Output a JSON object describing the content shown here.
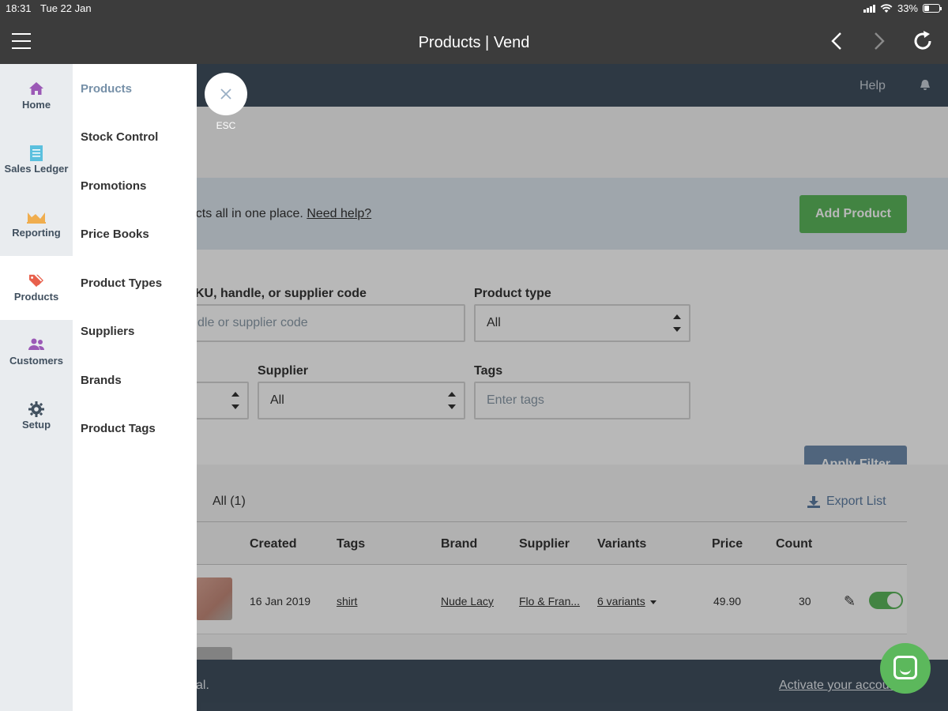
{
  "status_bar": {
    "time": "18:31",
    "date": "Tue 22 Jan",
    "battery": "33%"
  },
  "nav_bar": {
    "title": "Products | Vend"
  },
  "app_header": {
    "help": "Help"
  },
  "banner": {
    "text": "ducts all in one place.",
    "link": "Need help?",
    "add_product": "Add Product"
  },
  "filters": {
    "search_label": "KU, handle, or supplier code",
    "search_placeholder": "dle or supplier code",
    "product_type_label": "Product type",
    "product_type_value": "All",
    "supplier_label": "Supplier",
    "supplier_value": "All",
    "tags_label": "Tags",
    "tags_placeholder": "Enter tags",
    "apply_filter": "Apply Filter"
  },
  "list": {
    "tab_all": "All (1)",
    "export": "Export List",
    "columns": [
      "Created",
      "Tags",
      "Brand",
      "Supplier",
      "Variants",
      "Price",
      "Count"
    ],
    "rows": [
      {
        "created": "16 Jan 2019",
        "tags": "shirt",
        "brand": "Nude Lacy",
        "supplier": "Flo & Fran...",
        "variants": "6 variants",
        "price": "49.90",
        "count": "30"
      }
    ]
  },
  "footer": {
    "text": "al.",
    "link": "Activate your accou     w."
  },
  "rail": {
    "items": [
      {
        "label": "Home",
        "icon": "home-icon",
        "color": "#9b59b6"
      },
      {
        "label": "Sales Ledger",
        "icon": "ledger-icon",
        "color": "#5bc0de"
      },
      {
        "label": "Reporting",
        "icon": "reporting-icon",
        "color": "#f0ad4e"
      },
      {
        "label": "Products",
        "icon": "tag-icon",
        "color": "#e8604c"
      },
      {
        "label": "Customers",
        "icon": "customers-icon",
        "color": "#9b59b6"
      },
      {
        "label": "Setup",
        "icon": "gear-icon",
        "color": "#41505f"
      }
    ]
  },
  "submenu": {
    "items": [
      "Products",
      "Stock Control",
      "Promotions",
      "Price Books",
      "Product Types",
      "Suppliers",
      "Brands",
      "Product Tags"
    ]
  },
  "esc": {
    "label": "ESC"
  }
}
